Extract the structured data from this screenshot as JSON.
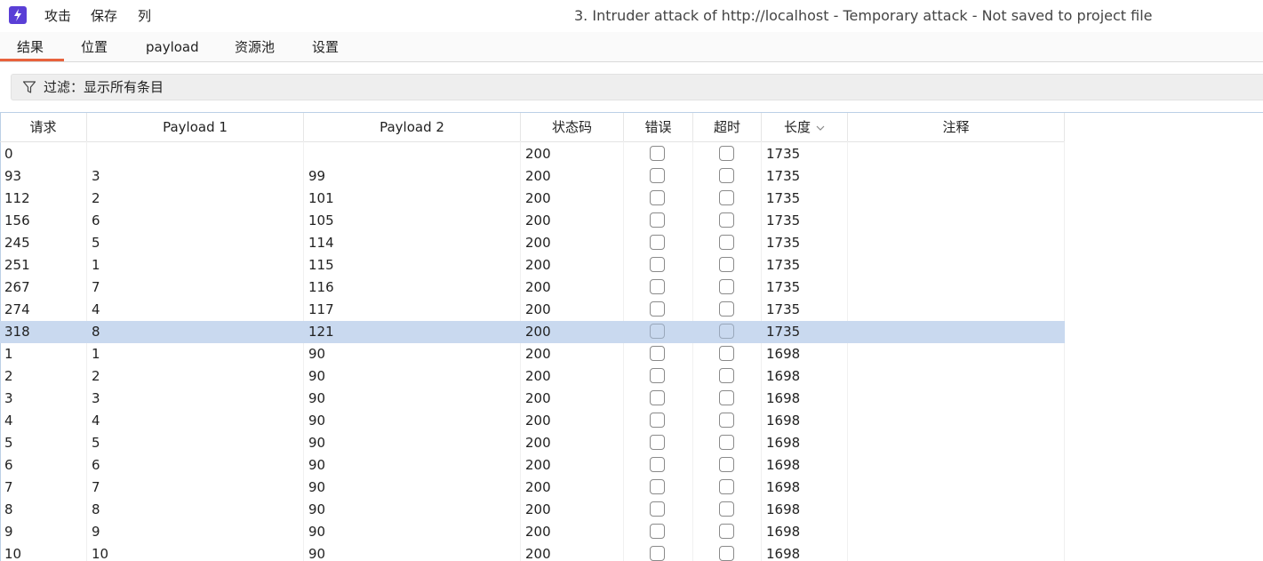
{
  "titlebar": {
    "menu": [
      "攻击",
      "保存",
      "列"
    ],
    "window_title": "3. Intruder attack of http://localhost - Temporary attack - Not saved to project file"
  },
  "tabs": [
    "结果",
    "位置",
    "payload",
    "资源池",
    "设置"
  ],
  "active_tab": "结果",
  "accent_color": "#e8623c",
  "selected_row_color": "#c9d9ef",
  "filter": {
    "text": "过滤：显示所有条目",
    "icon": "filter-icon"
  },
  "table": {
    "columns": [
      "请求",
      "Payload 1",
      "Payload 2",
      "状态码",
      "错误",
      "超时",
      "长度",
      "注释"
    ],
    "sort_column": "长度",
    "sort_icon": "chevron-down-icon",
    "selected_index": 8,
    "rows": [
      {
        "req": "0",
        "p1": "",
        "p2": "",
        "status": "200",
        "error": false,
        "timeout": false,
        "length": "1735",
        "comment": ""
      },
      {
        "req": "93",
        "p1": "3",
        "p2": "99",
        "status": "200",
        "error": false,
        "timeout": false,
        "length": "1735",
        "comment": ""
      },
      {
        "req": "112",
        "p1": "2",
        "p2": "101",
        "status": "200",
        "error": false,
        "timeout": false,
        "length": "1735",
        "comment": ""
      },
      {
        "req": "156",
        "p1": "6",
        "p2": "105",
        "status": "200",
        "error": false,
        "timeout": false,
        "length": "1735",
        "comment": ""
      },
      {
        "req": "245",
        "p1": "5",
        "p2": "114",
        "status": "200",
        "error": false,
        "timeout": false,
        "length": "1735",
        "comment": ""
      },
      {
        "req": "251",
        "p1": "1",
        "p2": "115",
        "status": "200",
        "error": false,
        "timeout": false,
        "length": "1735",
        "comment": ""
      },
      {
        "req": "267",
        "p1": "7",
        "p2": "116",
        "status": "200",
        "error": false,
        "timeout": false,
        "length": "1735",
        "comment": ""
      },
      {
        "req": "274",
        "p1": "4",
        "p2": "117",
        "status": "200",
        "error": false,
        "timeout": false,
        "length": "1735",
        "comment": ""
      },
      {
        "req": "318",
        "p1": "8",
        "p2": "121",
        "status": "200",
        "error": false,
        "timeout": false,
        "length": "1735",
        "comment": ""
      },
      {
        "req": "1",
        "p1": "1",
        "p2": "90",
        "status": "200",
        "error": false,
        "timeout": false,
        "length": "1698",
        "comment": ""
      },
      {
        "req": "2",
        "p1": "2",
        "p2": "90",
        "status": "200",
        "error": false,
        "timeout": false,
        "length": "1698",
        "comment": ""
      },
      {
        "req": "3",
        "p1": "3",
        "p2": "90",
        "status": "200",
        "error": false,
        "timeout": false,
        "length": "1698",
        "comment": ""
      },
      {
        "req": "4",
        "p1": "4",
        "p2": "90",
        "status": "200",
        "error": false,
        "timeout": false,
        "length": "1698",
        "comment": ""
      },
      {
        "req": "5",
        "p1": "5",
        "p2": "90",
        "status": "200",
        "error": false,
        "timeout": false,
        "length": "1698",
        "comment": ""
      },
      {
        "req": "6",
        "p1": "6",
        "p2": "90",
        "status": "200",
        "error": false,
        "timeout": false,
        "length": "1698",
        "comment": ""
      },
      {
        "req": "7",
        "p1": "7",
        "p2": "90",
        "status": "200",
        "error": false,
        "timeout": false,
        "length": "1698",
        "comment": ""
      },
      {
        "req": "8",
        "p1": "8",
        "p2": "90",
        "status": "200",
        "error": false,
        "timeout": false,
        "length": "1698",
        "comment": ""
      },
      {
        "req": "9",
        "p1": "9",
        "p2": "90",
        "status": "200",
        "error": false,
        "timeout": false,
        "length": "1698",
        "comment": ""
      },
      {
        "req": "10",
        "p1": "10",
        "p2": "90",
        "status": "200",
        "error": false,
        "timeout": false,
        "length": "1698",
        "comment": ""
      }
    ]
  }
}
